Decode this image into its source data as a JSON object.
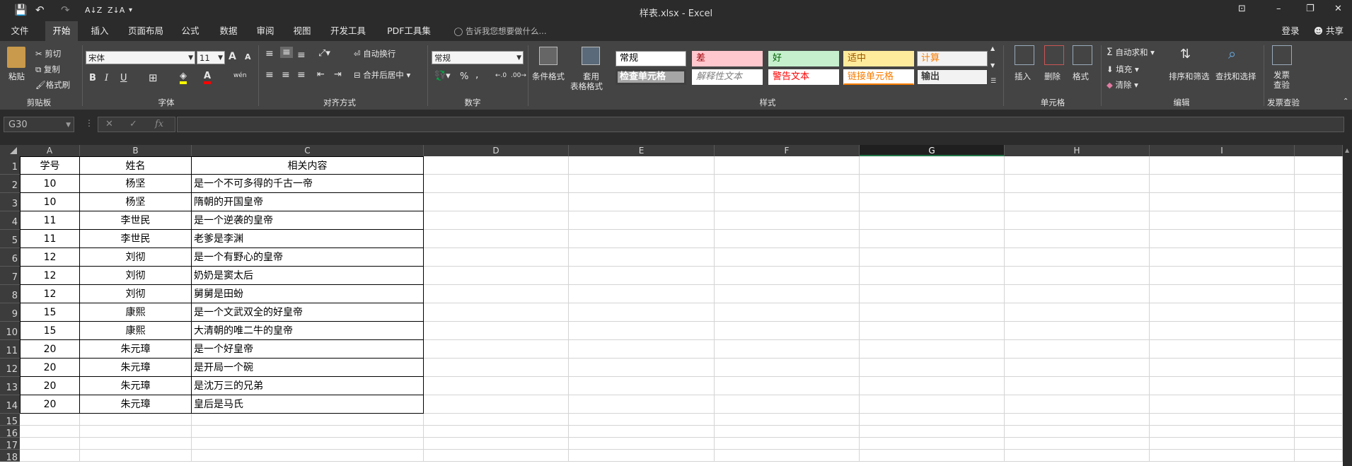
{
  "window": {
    "title": "样表.xlsx - Excel",
    "qat": {
      "save": "💾",
      "undo": "↶",
      "redo": "↷",
      "sort_asc": "A↓Z",
      "sort_desc": "Z↓A",
      "more": "▾"
    },
    "controls": {
      "ribbon_opts": "⊡",
      "minimize": "–",
      "restore": "❐",
      "close": "✕"
    }
  },
  "tabs": [
    "文件",
    "开始",
    "插入",
    "页面布局",
    "公式",
    "数据",
    "审阅",
    "视图",
    "开发工具",
    "PDF工具集"
  ],
  "tell_me": "告诉我您想要做什么...",
  "signin": "登录",
  "share": "共享",
  "ribbon": {
    "clipboard": {
      "paste": "粘贴",
      "cut": "剪切",
      "copy": "复制",
      "format_painter": "格式刷",
      "label": "剪贴板"
    },
    "font": {
      "name": "宋体",
      "size": "11",
      "grow": "A",
      "shrink": "A",
      "bold": "B",
      "italic": "I",
      "underline": "U",
      "wen": "wén",
      "label": "字体"
    },
    "alignment": {
      "wrap": "自动换行",
      "merge": "合并后居中",
      "label": "对齐方式"
    },
    "number": {
      "format": "常规",
      "percent": "%",
      "comma": ",",
      "label": "数字"
    },
    "styles": {
      "conditional": "条件格式",
      "table_line1": "套用",
      "table_line2": "表格格式",
      "cells": [
        {
          "text": "常规",
          "bg": "#ffffff",
          "color": "#000000",
          "border": "#7f7f7f"
        },
        {
          "text": "差",
          "bg": "#ffc7ce",
          "color": "#9c0006",
          "border": "#ffc7ce"
        },
        {
          "text": "好",
          "bg": "#c6efce",
          "color": "#006100",
          "border": "#c6efce"
        },
        {
          "text": "适中",
          "bg": "#ffeb9c",
          "color": "#9c5700",
          "border": "#ffeb9c"
        },
        {
          "text": "计算",
          "bg": "#f2f2f2",
          "color": "#fa7d00",
          "border": "#7f7f7f"
        },
        {
          "text": "检查单元格",
          "bg": "#a5a5a5",
          "color": "#ffffff",
          "border": "#3f3f3f"
        },
        {
          "text": "解释性文本",
          "bg": "#ffffff",
          "color": "#7f7f7f",
          "border": "#ffffff"
        },
        {
          "text": "警告文本",
          "bg": "#ffffff",
          "color": "#ff0000",
          "border": "#ffffff"
        },
        {
          "text": "链接单元格",
          "bg": "#ffffff",
          "color": "#fa7d00",
          "border": "#ffffff"
        },
        {
          "text": "输出",
          "bg": "#f2f2f2",
          "color": "#3f3f3f",
          "border": "#3f3f3f"
        }
      ],
      "label": "样式"
    },
    "cells": {
      "insert": "插入",
      "delete": "删除",
      "format": "格式",
      "label": "单元格"
    },
    "editing": {
      "autosum": "自动求和",
      "fill": "填充",
      "clear": "清除",
      "sort": "排序和筛选",
      "find": "查找和选择",
      "label": "编辑"
    },
    "invoice": {
      "line1": "发票",
      "line2": "查验",
      "label": "发票查验"
    }
  },
  "formula_bar": {
    "name_box": "G30",
    "cancel": "✕",
    "enter": "✓",
    "fx": "fx",
    "value": ""
  },
  "columns": [
    "A",
    "B",
    "C",
    "D",
    "E",
    "F",
    "G",
    "H",
    "I"
  ],
  "selected_column": "G",
  "rows": [
    [
      "学号",
      "姓名",
      "相关内容"
    ],
    [
      "10",
      "杨坚",
      "是一个不可多得的千古一帝"
    ],
    [
      "10",
      "杨坚",
      "隋朝的开国皇帝"
    ],
    [
      "11",
      "李世民",
      "是一个逆袭的皇帝"
    ],
    [
      "11",
      "李世民",
      "老爹是李渊"
    ],
    [
      "12",
      "刘彻",
      "是一个有野心的皇帝"
    ],
    [
      "12",
      "刘彻",
      "奶奶是窦太后"
    ],
    [
      "12",
      "刘彻",
      "舅舅是田蚡"
    ],
    [
      "15",
      "康熙",
      "是一个文武双全的好皇帝"
    ],
    [
      "15",
      "康熙",
      "大清朝的唯二牛的皇帝"
    ],
    [
      "20",
      "朱元璋",
      "是一个好皇帝"
    ],
    [
      "20",
      "朱元璋",
      "是开局一个碗"
    ],
    [
      "20",
      "朱元璋",
      "是沈万三的兄弟"
    ],
    [
      "20",
      "朱元璋",
      "皇后是马氏"
    ]
  ],
  "empty_rows": [
    "15",
    "16",
    "17",
    "18"
  ]
}
